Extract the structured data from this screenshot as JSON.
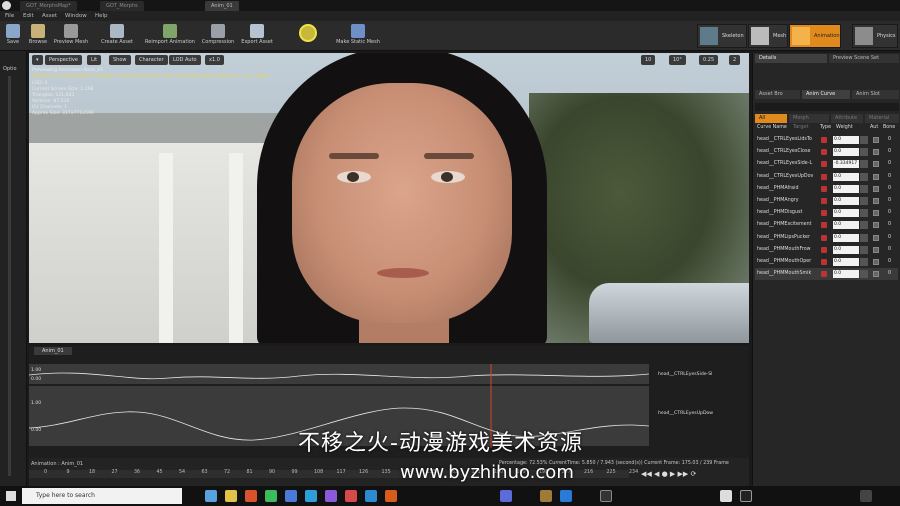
{
  "doc_tabs": [
    "GOT_MorphsMap*",
    "GOT_Morphs",
    "Anim_01"
  ],
  "menu": [
    "File",
    "Edit",
    "Asset",
    "Window",
    "Help"
  ],
  "toolbar": {
    "save": "Save",
    "browse": "Browse",
    "preview_mesh": "Preview Mesh",
    "create_asset": "Create Asset",
    "reimport": "Reimport Animation",
    "compression": "Compression",
    "export": "Export Asset",
    "make_static": "Make Static Mesh"
  },
  "modes": [
    "Skeleton",
    "Mesh",
    "Animation",
    "Physics"
  ],
  "left_strip": {
    "options": "Optio"
  },
  "viewport": {
    "toolbar": [
      "Perspective",
      "Lit",
      "Show",
      "Character",
      "LOD Auto",
      "x1.0"
    ],
    "stats": [
      "Previewing Animation Anim_01",
      "Animation is being edited. To apply to compressed data (and recalculate baked additives), click \"Apply\"",
      "LOD: 0",
      "Current Screen Size: 1.168",
      "Triangles: 131,023",
      "Vertices: 87,530",
      "UV Channels: 1",
      "Approx Size: 317x771x590"
    ],
    "right_values": [
      "10",
      "10°",
      "0.25",
      "2"
    ]
  },
  "right_panel": {
    "tabs": [
      "Details",
      "Preview Scene Set"
    ],
    "subtabs": [
      "Asset Bro",
      "Anim Curve",
      "Anim Slot"
    ],
    "filters": [
      "All Curves",
      "Morph Target",
      "Attribute",
      "Material"
    ],
    "columns": [
      "Curve Name",
      "Type",
      "Weight",
      "Aut",
      "Bone"
    ],
    "rows": [
      {
        "name": "head__CTRLEyesLidsTo",
        "weight": "0.0",
        "bone": "0"
      },
      {
        "name": "head__CTRLEyesClose",
        "weight": "0.0",
        "bone": "0"
      },
      {
        "name": "head__CTRLEyesSide-L",
        "weight": "-0.334917",
        "bone": "0"
      },
      {
        "name": "head__CTRLEyesUpDov",
        "weight": "0.0",
        "bone": "0"
      },
      {
        "name": "head__PHMAfraid",
        "weight": "0.0",
        "bone": "0"
      },
      {
        "name": "head__PHMAngry",
        "weight": "0.0",
        "bone": "0"
      },
      {
        "name": "head__PHMDisgust",
        "weight": "0.0",
        "bone": "0"
      },
      {
        "name": "head__PHMExcitement",
        "weight": "0.0",
        "bone": "0"
      },
      {
        "name": "head__PHMLipsPucker",
        "weight": "0.0",
        "bone": "0"
      },
      {
        "name": "head__PHMMouthFrow",
        "weight": "0.0",
        "bone": "0"
      },
      {
        "name": "head__PHMMouthOper",
        "weight": "0.0",
        "bone": "0"
      },
      {
        "name": "head__PHMMouthSmik",
        "weight": "0.0",
        "bone": "0"
      }
    ]
  },
  "timeline": {
    "tab": "Anim_01",
    "lanes": [
      "head__CTRLEyesSide-Sl",
      "head__CTRLEyesUpDow"
    ],
    "lane_values": [
      "1.00",
      "0.00",
      "1.00",
      "0.00"
    ],
    "footer_left": "Animation : Anim_01",
    "footer_status": "Percentage: 72.53% CurrentTime: 5.850 / 7.943 (second(s)) Current Frame: 175.03 / 239 Frame",
    "ticks": [
      "0",
      "9",
      "18",
      "27",
      "36",
      "45",
      "54",
      "63",
      "72",
      "81",
      "90",
      "99",
      "108",
      "117",
      "126",
      "135",
      "144",
      "153",
      "162",
      "171",
      "180",
      "189",
      "198",
      "207",
      "216",
      "225",
      "234"
    ]
  },
  "taskbar": {
    "search_placeholder": "Type here to search"
  },
  "watermark": {
    "cn": "不移之火-动漫游戏美术资源",
    "url": "www.byzhihuo.com"
  }
}
